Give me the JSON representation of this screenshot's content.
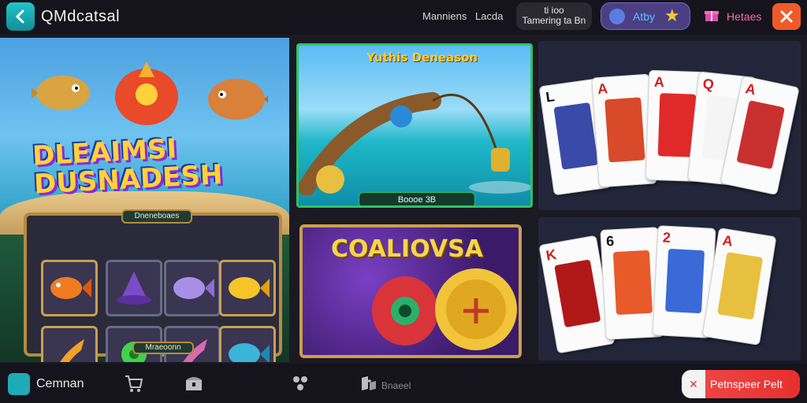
{
  "header": {
    "title": "QMdcatsal",
    "label_1": "Manniens",
    "label_2": "Lacda",
    "info_button": "ti ioo\nTamering ta Bn",
    "pill_label": "Atby",
    "link_label": "Hetaes"
  },
  "tiles": {
    "fish": {
      "title": "DLEAIMSI DUSNADESH",
      "slot_label": "Dneneboaes",
      "slot_bottom_label": "Mraeoonn"
    },
    "beach": {
      "title": "Yuthis Deneason",
      "footer": "Boooe 3B"
    },
    "gold": {
      "title": "COALIOVSA"
    },
    "cards_top": {
      "ranks": [
        "L",
        "A",
        "A",
        "Q",
        "A"
      ]
    },
    "cards_bottom": {
      "ranks": [
        "K",
        "6",
        "2",
        "A"
      ]
    }
  },
  "footer": {
    "home_label": "Cemnan",
    "nav_label_1": "Bnaeel",
    "cta_label": "Petnspeer Pelt"
  },
  "colors": {
    "accent_teal": "#1faab8",
    "close_orange": "#f05a2a",
    "cta_red": "#e82e2e",
    "beach_border": "#2ec266",
    "gold_border": "#c9a050"
  },
  "icons": {
    "back": "back-arrow-icon",
    "star": "star-icon",
    "gift": "gift-icon",
    "close": "close-icon",
    "cart": "cart-icon",
    "treasure": "treasure-icon",
    "dice": "dice-icon",
    "puzzle": "puzzle-icon"
  }
}
